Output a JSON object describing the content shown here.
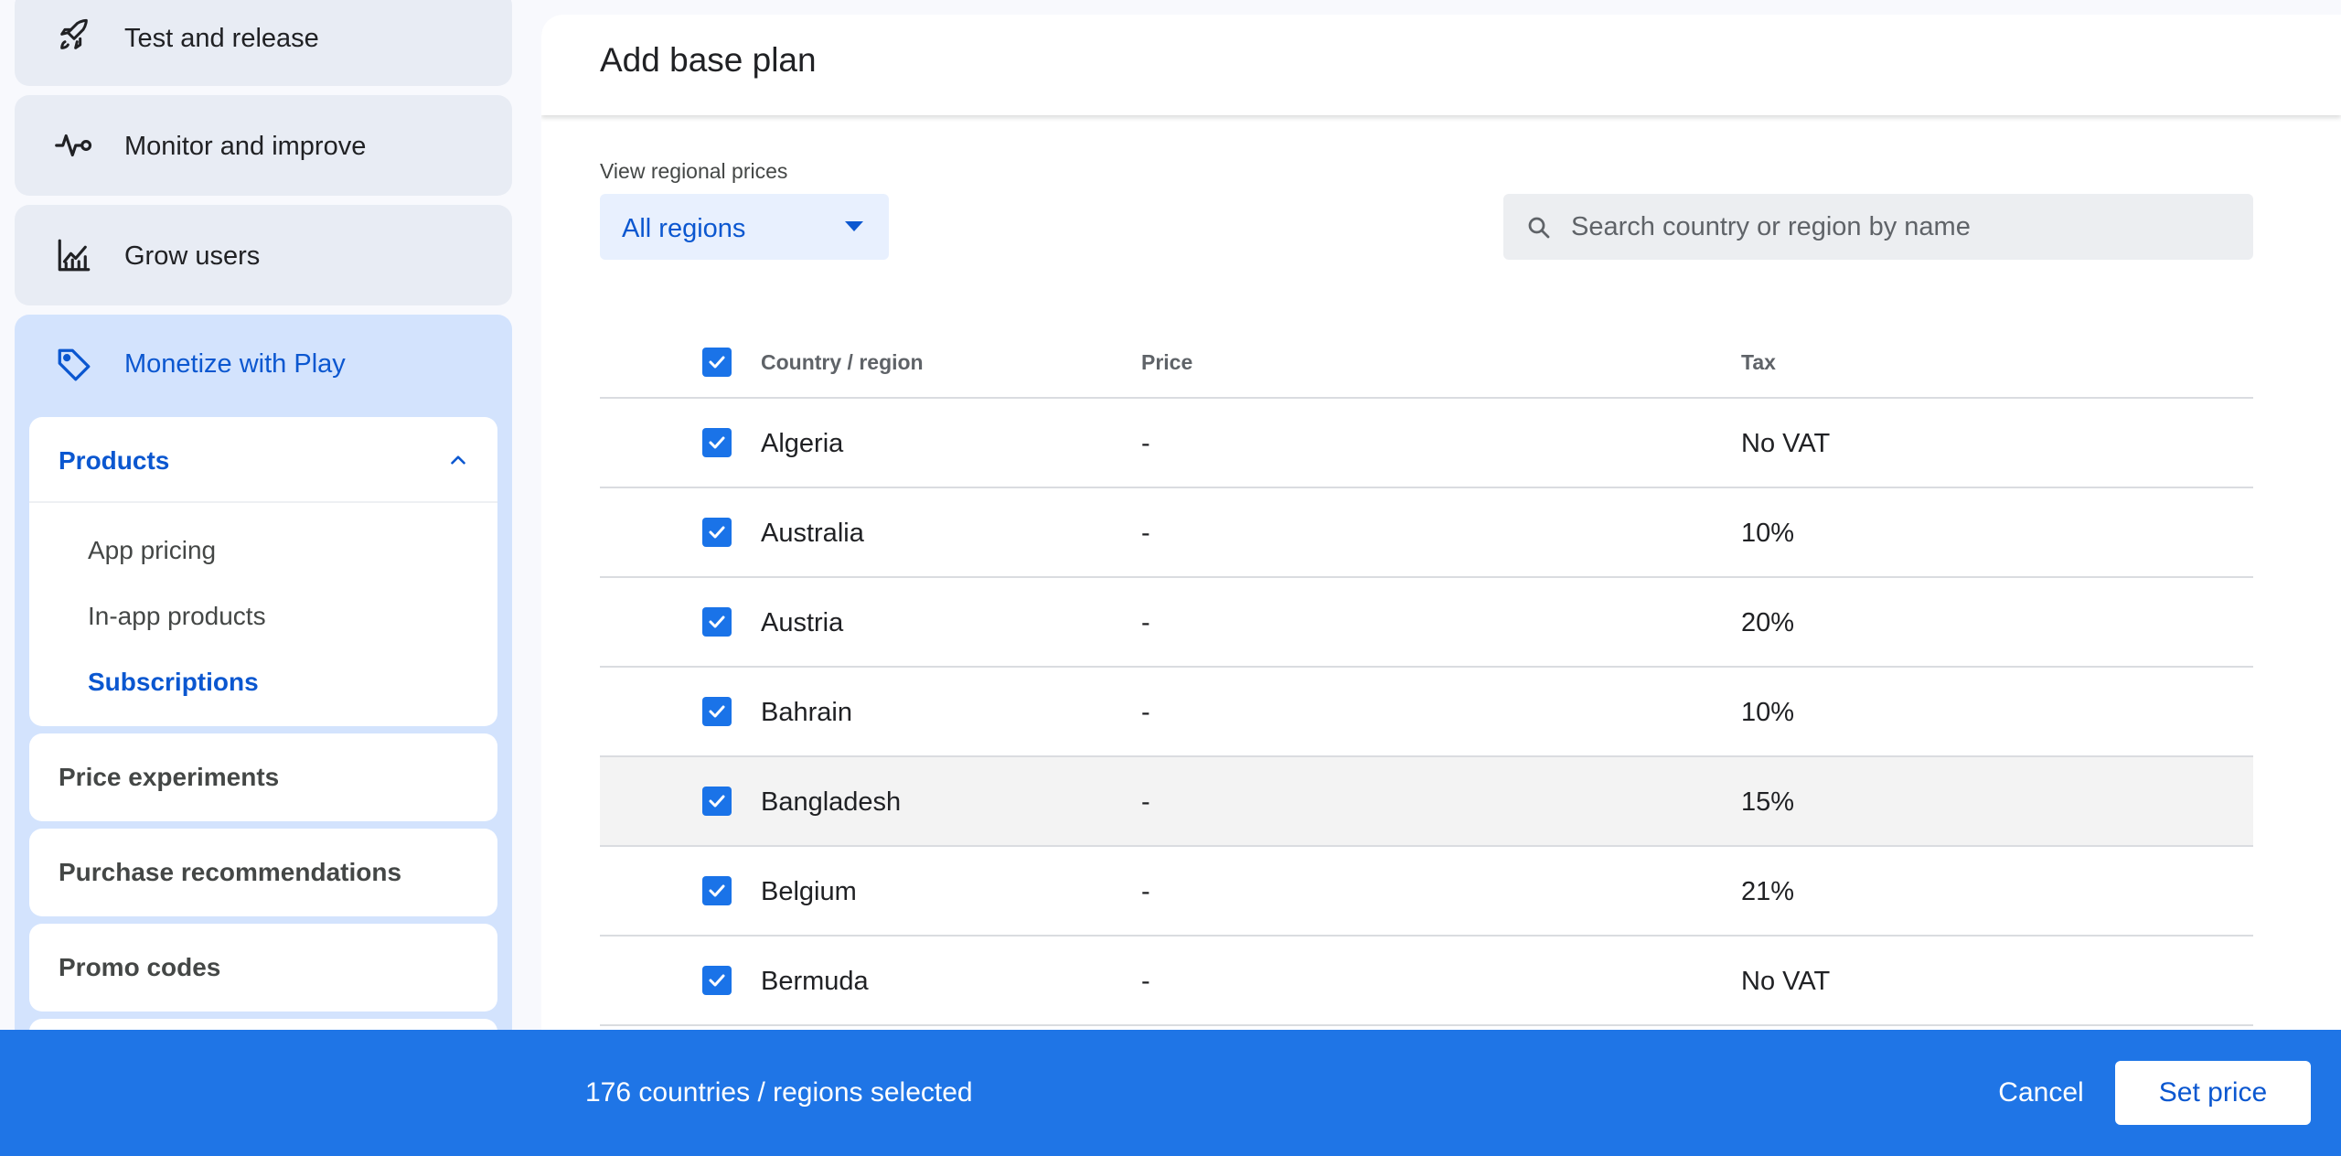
{
  "sidebar": {
    "test_release": "Test and release",
    "monitor_improve": "Monitor and improve",
    "grow_users": "Grow users",
    "monetize": "Monetize with Play",
    "products": {
      "label": "Products",
      "items": [
        "App pricing",
        "In-app products",
        "Subscriptions"
      ],
      "active": "Subscriptions"
    },
    "price_experiments": "Price experiments",
    "purchase_recommendations": "Purchase recommendations",
    "promo_codes": "Promo codes"
  },
  "main": {
    "title": "Add base plan",
    "view_regional_label": "View regional prices",
    "region_select_value": "All regions",
    "search_placeholder": "Search country or region by name"
  },
  "table": {
    "headers": {
      "country": "Country / region",
      "price": "Price",
      "tax": "Tax"
    },
    "rows": [
      {
        "country": "Algeria",
        "price": "-",
        "tax": "No VAT"
      },
      {
        "country": "Australia",
        "price": "-",
        "tax": "10%"
      },
      {
        "country": "Austria",
        "price": "-",
        "tax": "20%"
      },
      {
        "country": "Bahrain",
        "price": "-",
        "tax": "10%"
      },
      {
        "country": "Bangladesh",
        "price": "-",
        "tax": "15%"
      },
      {
        "country": "Belgium",
        "price": "-",
        "tax": "21%"
      },
      {
        "country": "Bermuda",
        "price": "-",
        "tax": "No VAT"
      }
    ]
  },
  "bottom_bar": {
    "selected_text": "176 countries / regions selected",
    "cancel_label": "Cancel",
    "set_price_label": "Set price"
  },
  "colors": {
    "accent": "#0b57d0",
    "bottom_bar": "#1f75e6",
    "checkbox": "#1a73e8"
  }
}
